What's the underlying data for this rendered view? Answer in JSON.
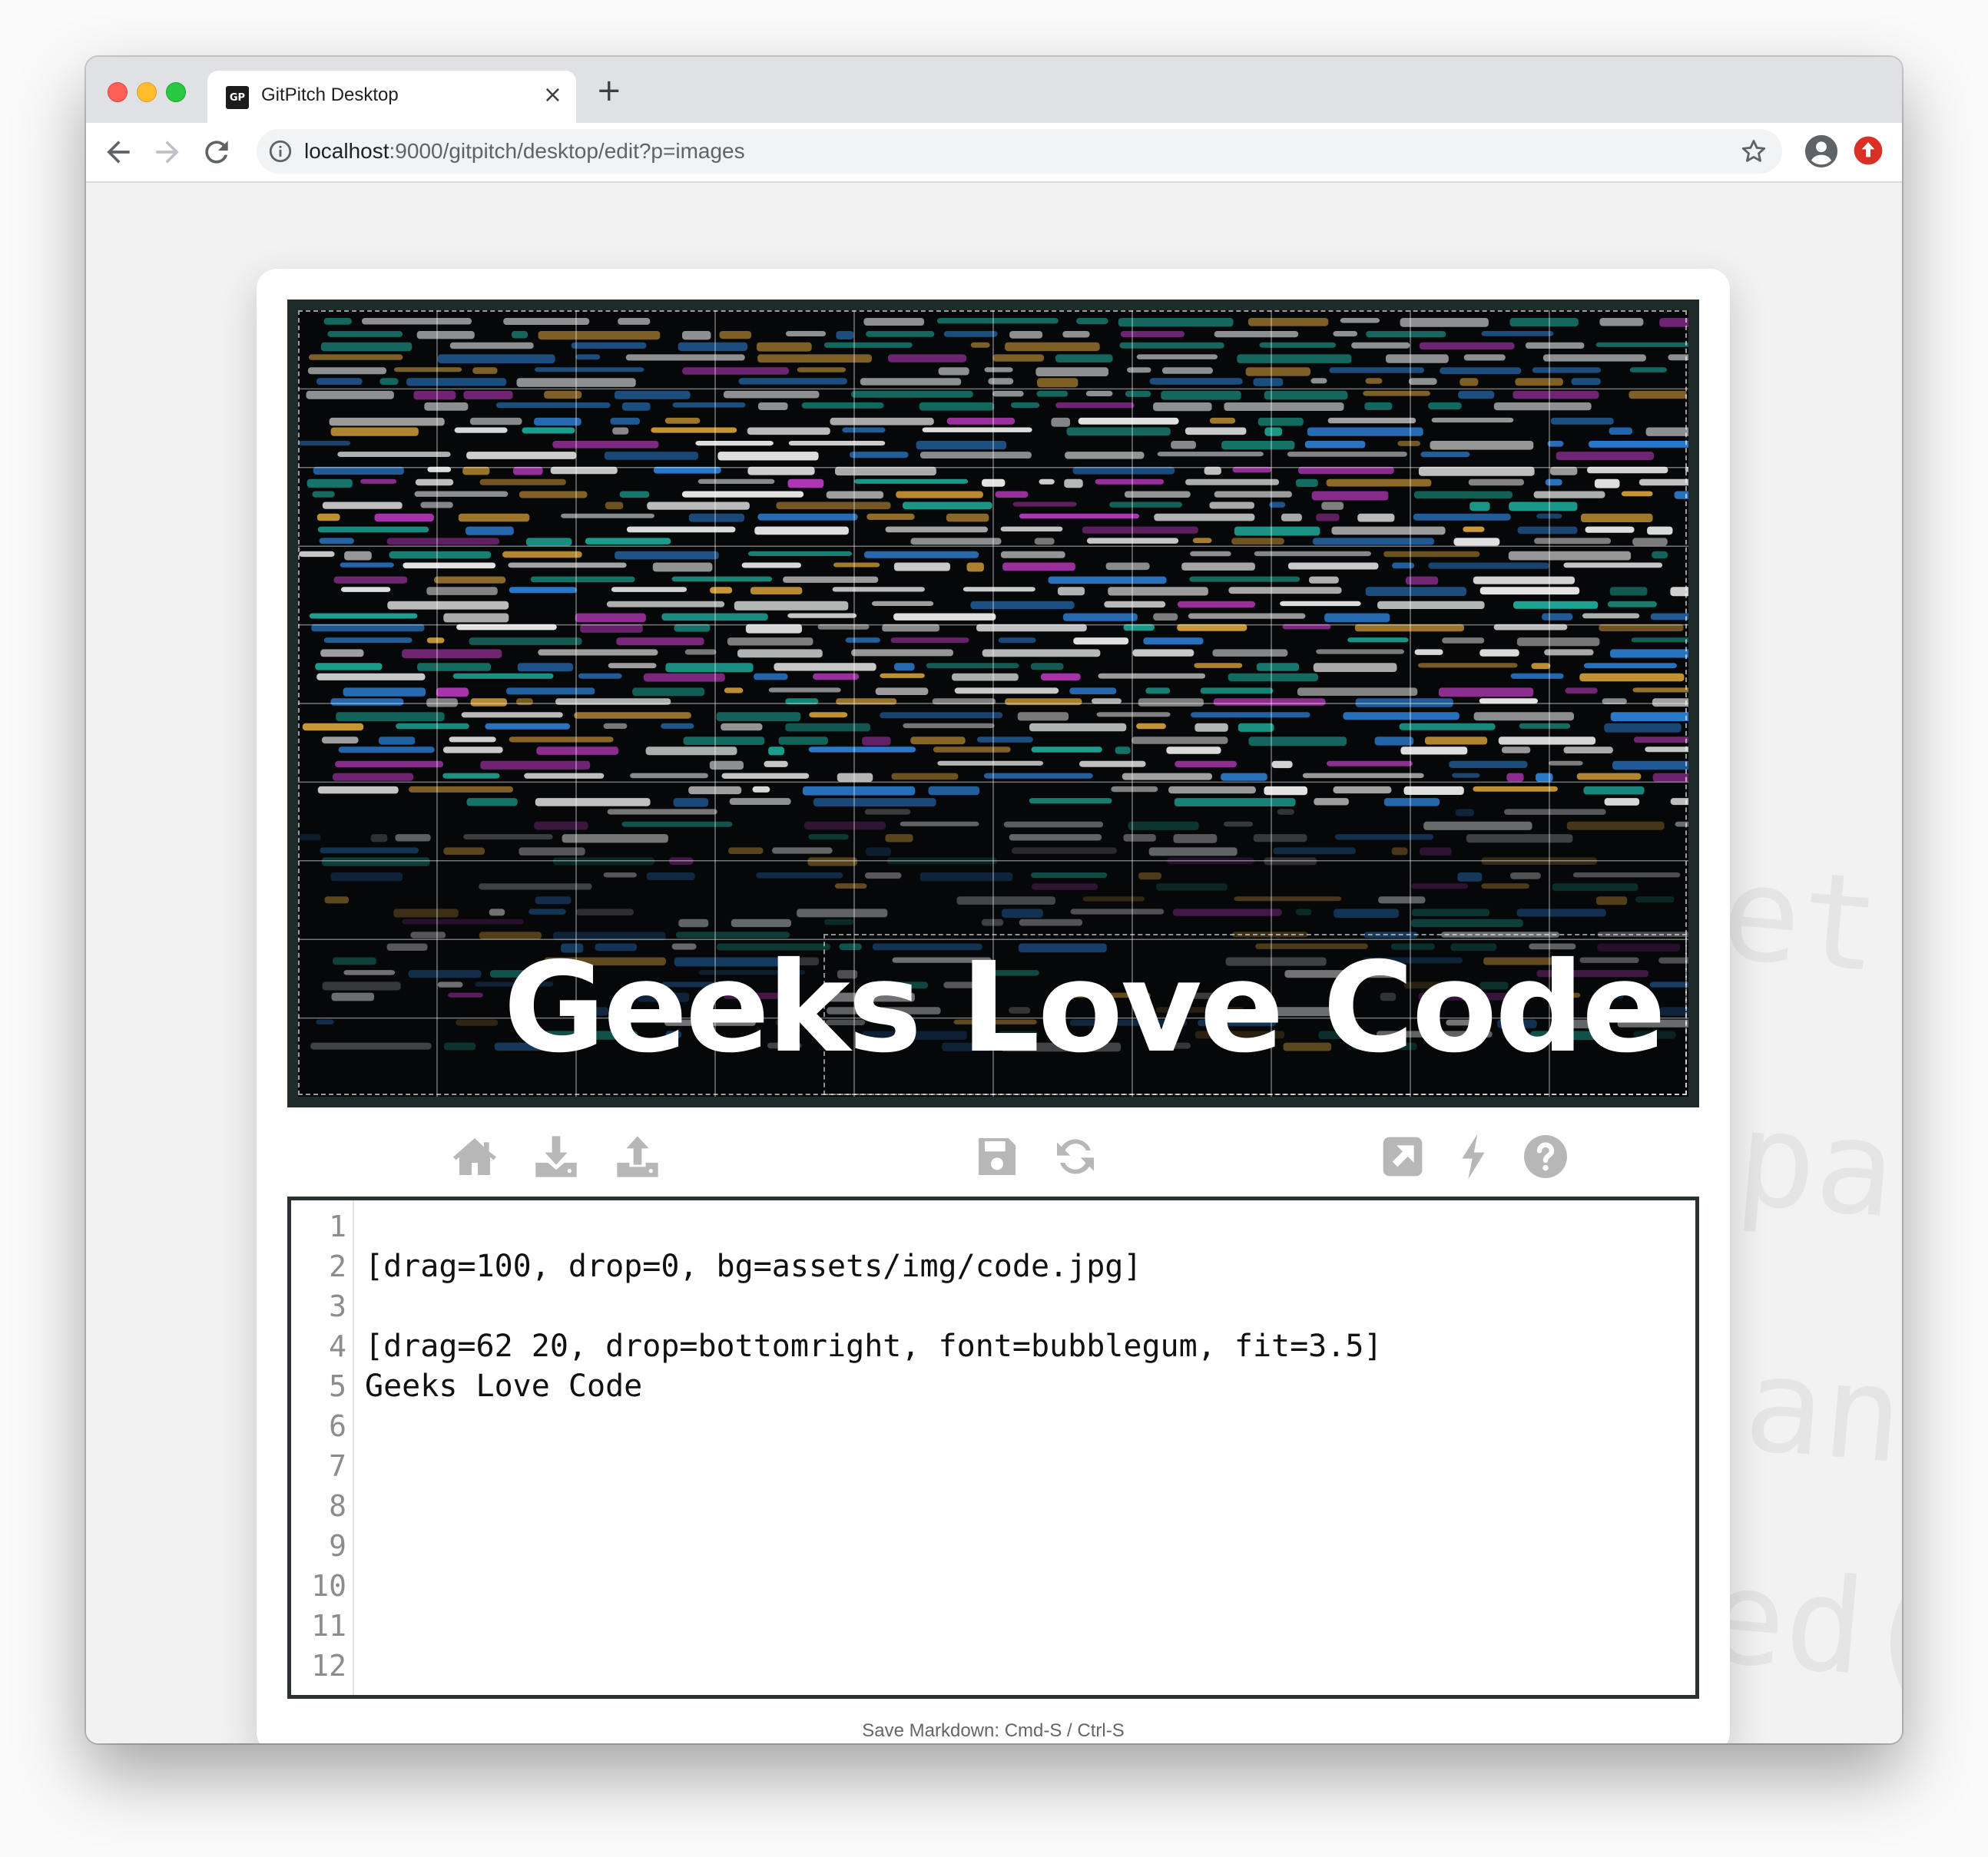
{
  "browser": {
    "tab_title": "GitPitch Desktop",
    "tab_favicon": "GP",
    "tab_close": "×",
    "new_tab": "+",
    "url_host": "localhost",
    "url_rest": ":9000/gitpitch/desktop/edit?p=images",
    "icons": {
      "back": "back-arrow-icon",
      "forward": "forward-arrow-icon",
      "reload": "reload-icon",
      "info": "info-icon",
      "star": "star-icon",
      "profile": "profile-icon",
      "update": "update-icon"
    }
  },
  "slide": {
    "title": "Geeks Love Code",
    "background": "code-image",
    "accent_colors": [
      "#1fb7a4",
      "#e2a83c",
      "#2e86e0",
      "#c43cc8"
    ]
  },
  "actions": {
    "left": [
      "home-icon",
      "download-icon",
      "upload-icon"
    ],
    "center": [
      "save-icon",
      "refresh-icon"
    ],
    "right": [
      "external-link-icon",
      "lightning-icon",
      "help-icon"
    ]
  },
  "editor": {
    "line_numbers": [
      "1",
      "2",
      "3",
      "4",
      "5",
      "6",
      "7",
      "8",
      "9",
      "10",
      "11",
      "12"
    ],
    "lines": [
      "",
      "[drag=100, drop=0, bg=assets/img/code.jpg]",
      "",
      "[drag=62 20, drop=bottomright, font=bubblegum, fit=3.5]",
      "Geeks Love Code",
      "",
      "",
      "",
      "",
      "",
      "",
      ""
    ]
  },
  "footer": {
    "hint": "Save Markdown: Cmd-S / Ctrl-S"
  },
  "background_words": [
    "et",
    "pa",
    "an",
    "ed("
  ]
}
